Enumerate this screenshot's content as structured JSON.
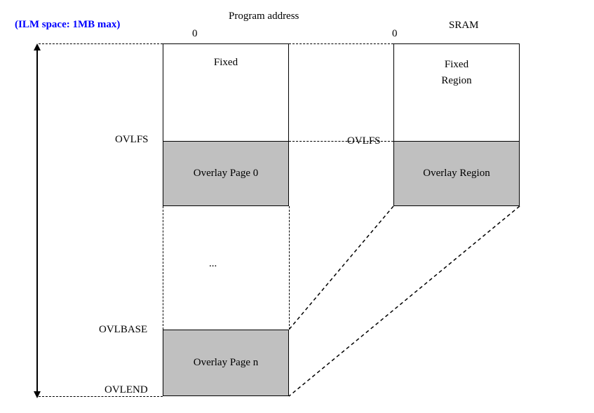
{
  "ilm_note": "(ILM space: 1MB max)",
  "header": {
    "program_address": "Program address",
    "sram": "SRAM",
    "zero_left": "0",
    "zero_right": "0"
  },
  "labels": {
    "ovlfs_left": "OVLFS",
    "ovlfs_right": "OVLFS",
    "ovlbase": "OVLBASE",
    "ovlend": "OVLEND",
    "ellipsis": "..."
  },
  "boxes": {
    "fixed": "Fixed",
    "fixed_region": "Fixed\nRegion",
    "overlay_page_0": "Overlay Page 0",
    "overlay_region": "Overlay Region",
    "overlay_page_n": "Overlay Page n"
  }
}
